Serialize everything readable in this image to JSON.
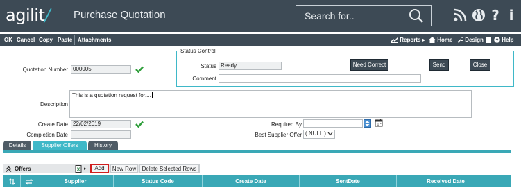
{
  "header": {
    "logo_text": "agilit",
    "logo_slash": "/",
    "title": "Purchase Quotation",
    "search_placeholder": "Search for.."
  },
  "toolbar": {
    "ok": "OK",
    "cancel": "Cancel",
    "copy": "Copy",
    "paste": "Paste",
    "attachments": "Attachments",
    "reports": "Reports",
    "home": "Home",
    "design": "Design",
    "help": "Help"
  },
  "form": {
    "quotation_number_label": "Quotation Number",
    "quotation_number_value": "000005",
    "description_label": "Description",
    "description_value": "This is a quotation request for....",
    "create_date_label": "Create Date",
    "create_date_value": "22/02/2019",
    "completion_date_label": "Completion Date",
    "completion_date_value": "",
    "required_by_label": "Required By",
    "required_by_value": "",
    "best_supplier_label": "Best Supplier Offer",
    "best_supplier_value": "( NULL )"
  },
  "status_control": {
    "legend": "Status Control",
    "status_label": "Status",
    "status_value": "Ready",
    "comment_label": "Comment",
    "comment_value": "",
    "need_correct_label": "Need Correct",
    "send_label": "Send",
    "close_label": "Close"
  },
  "tabs": [
    {
      "label": "Details",
      "active": false
    },
    {
      "label": "Supplier Offers",
      "active": true
    },
    {
      "label": "History",
      "active": false
    }
  ],
  "grid": {
    "title": "Offers",
    "add_label": "Add",
    "new_row_label": "New Row",
    "delete_rows_label": "Delete Selected Rows",
    "columns": [
      "Supplier",
      "Status Code",
      "Create Date",
      "SentDate",
      "Received Date"
    ]
  },
  "colors": {
    "header_bg": "#3d4a55",
    "accent_teal": "#3fb8c8",
    "check_green": "#2e9e3a",
    "highlight_red": "#d11f1f"
  }
}
